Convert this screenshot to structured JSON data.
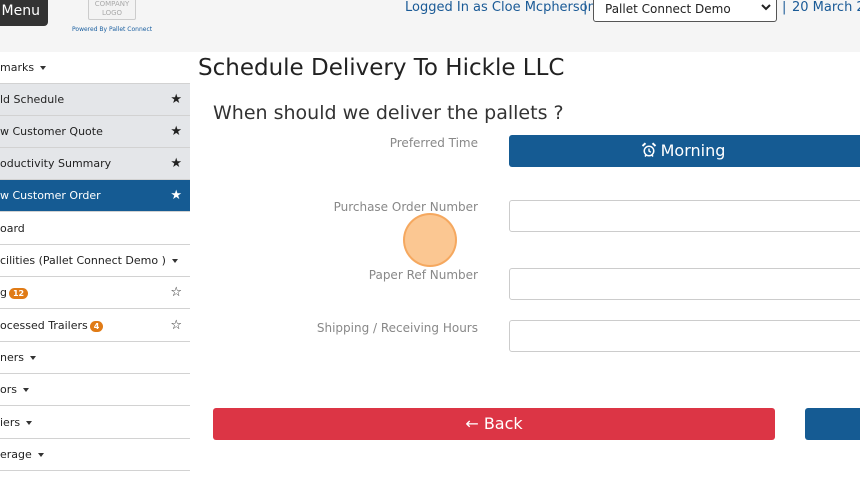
{
  "header": {
    "menu_label": "Menu",
    "logo_text": "COMPANY LOGO",
    "powered_by": "Powered By Pallet Connect",
    "logged_in": "Logged In as Cloe Mcpherson",
    "separator": "|",
    "site_select_value": "Pallet Connect Demo",
    "date": "20 March 2"
  },
  "sidebar": {
    "items": [
      {
        "label": "marks",
        "caret": true
      },
      {
        "label": "ld Schedule",
        "star": "★"
      },
      {
        "label": "w Customer Quote",
        "star": "★"
      },
      {
        "label": "oductivity Summary",
        "star": "★"
      },
      {
        "label": "w Customer Order",
        "star": "★"
      },
      {
        "label": "oard"
      },
      {
        "label": "cilities (Pallet Connect Demo )",
        "caret": true
      },
      {
        "label": "g",
        "badge": "12",
        "star": "☆"
      },
      {
        "label": "ocessed Trailers",
        "badge": "4",
        "star": "☆"
      },
      {
        "label": "ners",
        "caret": true
      },
      {
        "label": "ors",
        "caret": true
      },
      {
        "label": "iers",
        "caret": true
      },
      {
        "label": "erage",
        "caret": true
      }
    ]
  },
  "main": {
    "title": "Schedule Delivery To Hickle LLC",
    "question": "When should we deliver the pallets ?",
    "fields": {
      "preferred_time_label": "Preferred Time",
      "preferred_time_value": "Morning",
      "po_number_label": "Purchase Order Number",
      "po_number_value": "",
      "paper_ref_label": "Paper Ref Number",
      "paper_ref_value": "",
      "hours_label": "Shipping / Receiving Hours",
      "hours_value": ""
    },
    "back_label": "← Back"
  },
  "colors": {
    "primary": "#155b93",
    "danger": "#dc3545",
    "badge": "#e07b16"
  }
}
